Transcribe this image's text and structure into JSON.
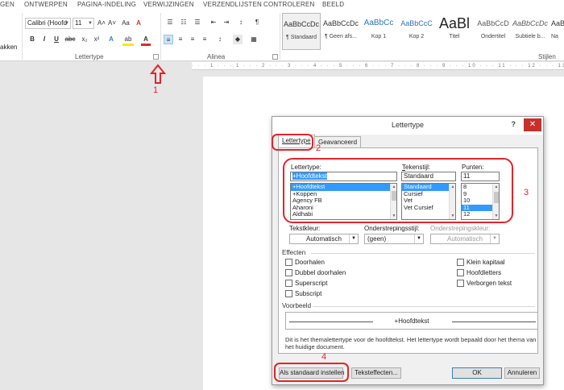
{
  "ribbon": {
    "tabs": [
      "GEN",
      "ONTWERPEN",
      "PAGINA-INDELING",
      "VERWIJZINGEN",
      "VERZENDLIJSTEN",
      "CONTROLEREN",
      "BEELD"
    ],
    "clipboard_partial_label": "akken",
    "font_name": "Calibri (Hoofd",
    "font_size": "11",
    "grow_font_glyph": "A˄",
    "shrink_font_glyph": "A˅",
    "case_glyph": "Aa",
    "clear_format_glyph": "A",
    "bold": "B",
    "italic": "I",
    "underline": "U",
    "strikethrough": "abc",
    "subscript_glyph": "x₂",
    "superscript_glyph": "x²",
    "text_effects_glyph": "A",
    "highlight_glyph": "ab",
    "font_color_glyph": "A",
    "group_font": "Lettertype",
    "group_paragraph": "Alinea",
    "group_styles": "Stijlen",
    "accent_red": "#e3242b",
    "styles": [
      {
        "preview": "AaBbCcDc",
        "name": "¶ Standaard",
        "color": "#333333"
      },
      {
        "preview": "AaBbCcDc",
        "name": "¶ Geen afs...",
        "color": "#333333"
      },
      {
        "preview": "AaBbCc",
        "name": "Kop 1",
        "color": "#2e74b5"
      },
      {
        "preview": "AaBbCcC",
        "name": "Kop 2",
        "color": "#2e74b5"
      },
      {
        "preview": "AaBl",
        "name": "Titel",
        "color": "#222222"
      },
      {
        "preview": "AaBbCcD",
        "name": "Ondertitel",
        "color": "#595959"
      },
      {
        "preview": "AaBbCcDc",
        "name": "Subtiele b...",
        "color": "#595959"
      },
      {
        "preview": "AaB",
        "name": "Na",
        "color": "#333333"
      }
    ]
  },
  "ruler_text": "· · · 1 · · · 1 · · · 2 · · · 3 · · · 4 · · · 5 · · · 6 · · · 7 · · · 8 · · · 9 · · · 10 · · · 11 · · · 12 · · · 13",
  "annotations": [
    "1",
    "2",
    "3",
    "4"
  ],
  "dialog": {
    "title": "Lettertype",
    "help": "?",
    "close": "✕",
    "tab_font": "Lettertype",
    "tab_advanced": "Geavanceerd",
    "font_label": "Lettertype:",
    "font_value": "+Hoofdtekst",
    "font_list": [
      "+Hoofdtekst",
      "+Koppen",
      "Agency FB",
      "Aharoni",
      "Aldhabi"
    ],
    "style_label": "Tekenstijl:",
    "style_value": "Standaard",
    "style_list": [
      "Standaard",
      "Cursief",
      "Vet",
      "Vet Cursief"
    ],
    "size_label": "Punten:",
    "size_value": "11",
    "size_list": [
      "8",
      "9",
      "10",
      "11",
      "12"
    ],
    "color_label": "Tekstkleur:",
    "color_value": "Automatisch",
    "underline_label": "Onderstrepingsstijl:",
    "underline_value": "(geen)",
    "underline_color_label": "Onderstrepingskleur:",
    "underline_color_value": "Automatisch",
    "effects_label": "Effecten",
    "effects_left": [
      "Doorhalen",
      "Dubbel doorhalen",
      "Superscript",
      "Subscript"
    ],
    "effects_right": [
      "Klein kapitaal",
      "Hoofdletters",
      "Verborgen tekst"
    ],
    "preview_label": "Voorbeeld",
    "preview_text": "+Hoofdtekst",
    "description": "Dit is het themalettertype voor de hoofdtekst. Het lettertype wordt bepaald door het thema van het huidige document.",
    "btn_default": "Als standaard instellen",
    "btn_effects": "Teksteffecten...",
    "btn_ok": "OK",
    "btn_cancel": "Annuleren"
  }
}
